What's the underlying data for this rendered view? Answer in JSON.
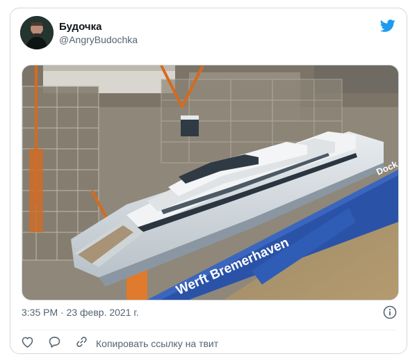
{
  "tweet": {
    "author_name": "Будочка",
    "author_handle": "@AngryBudochka",
    "timestamp": "3:35 PM · 23 февр. 2021 г.",
    "copy_link_label": "Копировать ссылку на твит"
  },
  "photo": {
    "hull_text": "Werft Bremerhaven",
    "dock_text": "Dock"
  },
  "colors": {
    "twitter_blue": "#1d9bf0",
    "border": "#cfd9de",
    "secondary_text": "#536471",
    "dock_blue": "#2a53a8"
  },
  "icons": [
    "twitter-bird-icon",
    "info-icon",
    "heart-icon",
    "reply-icon",
    "link-icon"
  ]
}
